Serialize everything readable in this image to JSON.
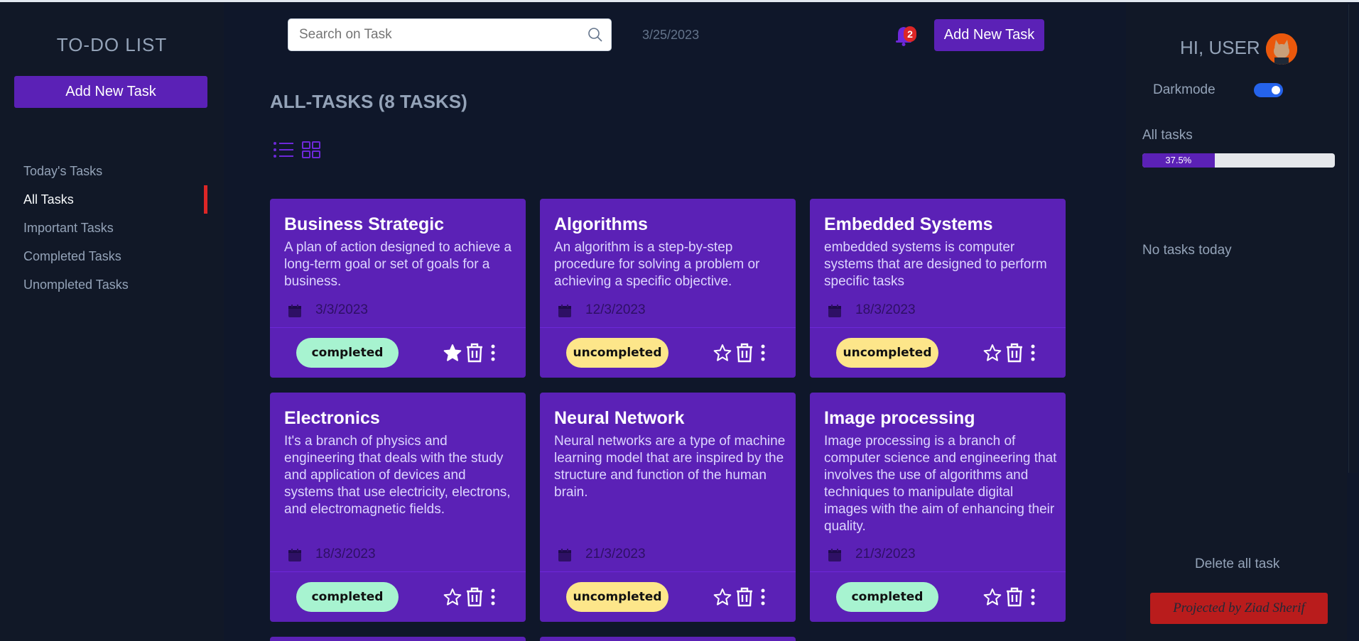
{
  "sidebar": {
    "title": "TO-DO LIST",
    "add_button": "Add New Task",
    "nav": [
      {
        "label": "Today's Tasks",
        "active": false
      },
      {
        "label": "All Tasks",
        "active": true
      },
      {
        "label": "Important Tasks",
        "active": false
      },
      {
        "label": "Completed Tasks",
        "active": false
      },
      {
        "label": "Unompleted Tasks",
        "active": false
      }
    ]
  },
  "header": {
    "search_placeholder": "Search on Task",
    "date": "3/25/2023",
    "notification_count": "2",
    "add_button": "Add New Task"
  },
  "main": {
    "title": "ALL-TASKS (8 TASKS)",
    "view_mode": "list",
    "tasks": [
      {
        "title": "Business Strategic",
        "description": "A plan of action designed to achieve a long-term goal or set of goals for a business.",
        "date": "3/3/2023",
        "status": "completed",
        "important": true
      },
      {
        "title": "Algorithms",
        "description": "An algorithm is a step-by-step procedure for solving a problem or achieving a specific objective.",
        "date": "12/3/2023",
        "status": "uncompleted",
        "important": false
      },
      {
        "title": "Embedded Systems",
        "description": "embedded systems is computer systems that are designed to perform specific tasks",
        "date": "18/3/2023",
        "status": "uncompleted",
        "important": false
      },
      {
        "title": "Electronics",
        "description": "It's a branch of physics and engineering that deals with the study and application of devices and systems that use electricity, electrons, and electromagnetic fields.",
        "date": "18/3/2023",
        "status": "completed",
        "important": false
      },
      {
        "title": "Neural Network",
        "description": "Neural networks are a type of machine learning model that are inspired by the structure and function of the human brain.",
        "date": "21/3/2023",
        "status": "uncompleted",
        "important": false
      },
      {
        "title": "Image processing",
        "description": "Image processing is a branch of computer science and engineering that involves the use of algorithms and techniques to manipulate digital images with the aim of enhancing their quality.",
        "date": "21/3/2023",
        "status": "completed",
        "important": false
      }
    ]
  },
  "right_panel": {
    "greeting": "HI, USER",
    "darkmode_label": "Darkmode",
    "darkmode_on": true,
    "all_tasks_label": "All tasks",
    "progress_text": "37.5%",
    "progress_fraction": 0.375,
    "no_tasks_text": "No tasks today",
    "delete_all": "Delete all task",
    "credit": "Projected by Ziad Sherif"
  },
  "colors": {
    "background": "#0f172a",
    "panel": "#111827",
    "accent": "#5b21b6",
    "completed": "#a7f3d0",
    "uncompleted": "#fde68a",
    "danger": "#dc2626"
  }
}
